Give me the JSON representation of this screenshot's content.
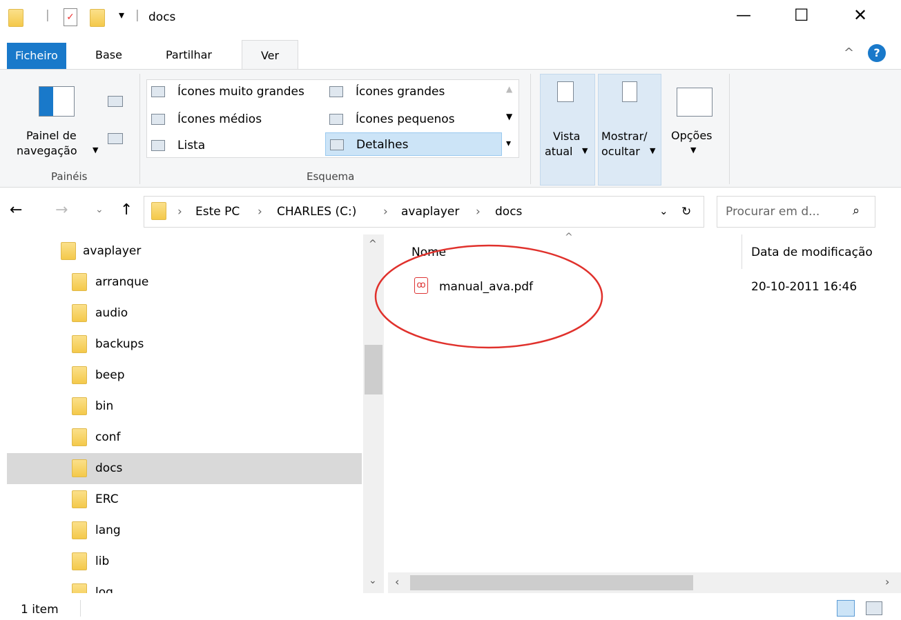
{
  "titlebar": {
    "title": "docs",
    "minimize": "—",
    "maximize": "☐",
    "close": "✕"
  },
  "tabs": [
    "Ficheiro",
    "Base",
    "Partilhar",
    "Ver"
  ],
  "ribbon": {
    "nav_pane_label_line1": "Painel de",
    "nav_pane_label_line2": "navegação",
    "group_panes": "Painéis",
    "gallery": {
      "extra_large": "Ícones muito grandes",
      "large": "Ícones grandes",
      "medium": "Ícones médios",
      "small": "Ícones pequenos",
      "list": "Lista",
      "details": "Detalhes"
    },
    "group_layout": "Esquema",
    "current_view_line1": "Vista",
    "current_view_line2": "atual",
    "show_hide_line1": "Mostrar/",
    "show_hide_line2": "ocultar",
    "options": "Opções"
  },
  "address": {
    "crumbs": [
      "Este PC",
      "CHARLES (C:)",
      "avaplayer",
      "docs"
    ],
    "search_placeholder": "Procurar em d..."
  },
  "nav_items": [
    "avaplayer",
    "arranque",
    "audio",
    "backups",
    "beep",
    "bin",
    "conf",
    "docs",
    "ERC",
    "lang",
    "lib",
    "log"
  ],
  "columns": {
    "name": "Nome",
    "date": "Data de modificação"
  },
  "files": [
    {
      "name": "manual_ava.pdf",
      "date": "20-10-2011 16:46"
    }
  ],
  "status": {
    "count": "1 item"
  }
}
